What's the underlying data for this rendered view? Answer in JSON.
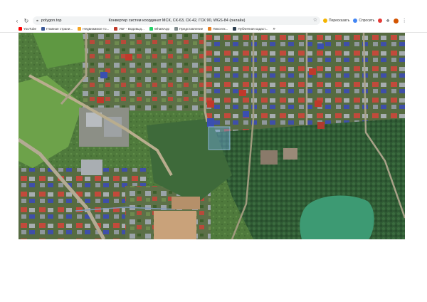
{
  "browser": {
    "url": "polygon.top",
    "tab_title": "Конвертер систем координат МСК, СК-63, СК-42, ГСК 90, WGS-84 (онлайн)",
    "extensions": [
      {
        "label": "Пересказать",
        "color": "#f4b400"
      },
      {
        "label": "Спросить",
        "color": "#4285f4"
      }
    ]
  },
  "bookmarks": [
    {
      "label": "YouTube",
      "color": "#ff0000"
    },
    {
      "label": "Главная страни...",
      "color": "#3b5998"
    },
    {
      "label": "Недвижимое то...",
      "color": "#f6a623"
    },
    {
      "label": "УБГ - Водовыд...",
      "color": "#c0392b"
    },
    {
      "label": "WhatsApp",
      "color": "#25d366"
    },
    {
      "label": "Представление",
      "color": "#7f8c8d"
    },
    {
      "label": "Пикселк...",
      "color": "#e67e22"
    },
    {
      "label": "Публичная кадаст...",
      "color": "#2c3e50"
    }
  ],
  "icons": {
    "back": "arrow-left-icon",
    "reload": "reload-icon",
    "lock": "site-info-icon",
    "star": "star-icon"
  },
  "colors": {
    "selection_polygon": "#6fa8dc",
    "lake": "#3d9a73",
    "roof_red": "#c0392b",
    "roof_blue": "#3a4fb0"
  }
}
